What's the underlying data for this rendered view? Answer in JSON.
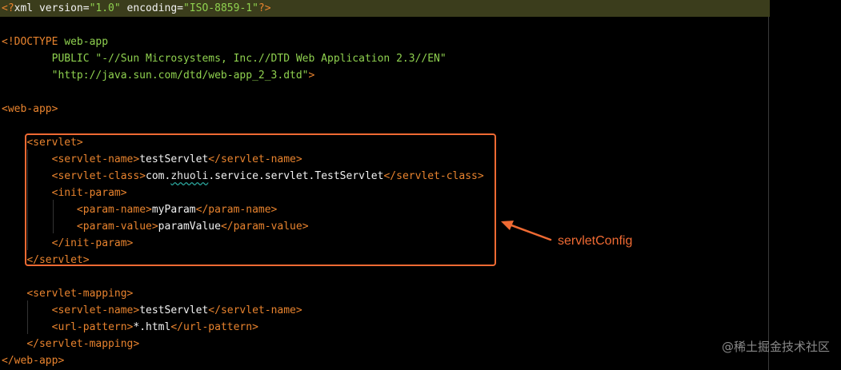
{
  "code_lines": [
    {
      "parts": [
        {
          "t": "<?",
          "c": "tag"
        },
        {
          "t": "xml version=",
          "c": "txt"
        },
        {
          "t": "\"1.0\"",
          "c": "str"
        },
        {
          "t": " encoding=",
          "c": "txt"
        },
        {
          "t": "\"ISO-8859-1\"",
          "c": "str"
        },
        {
          "t": "?>",
          "c": "tag"
        }
      ]
    },
    {
      "parts": []
    },
    {
      "parts": [
        {
          "t": "<!DOCTYPE",
          "c": "tag"
        },
        {
          "t": " web-app",
          "c": "str"
        }
      ]
    },
    {
      "parts": [
        {
          "t": "        PUBLIC ",
          "c": "str"
        },
        {
          "t": "\"-//Sun Microsystems, Inc.//DTD Web Application 2.3//EN\"",
          "c": "str"
        }
      ]
    },
    {
      "parts": [
        {
          "t": "        \"http://java.sun.com/dtd/web-app_2_3.dtd\"",
          "c": "str"
        },
        {
          "t": ">",
          "c": "tag"
        }
      ]
    },
    {
      "parts": []
    },
    {
      "parts": [
        {
          "t": "<web-app>",
          "c": "tag"
        }
      ]
    },
    {
      "parts": []
    },
    {
      "parts": [
        {
          "t": "    ",
          "c": "txt"
        },
        {
          "t": "<servlet>",
          "c": "tag"
        }
      ]
    },
    {
      "parts": [
        {
          "t": "        ",
          "c": "txt"
        },
        {
          "t": "<servlet-name>",
          "c": "tag"
        },
        {
          "t": "testServlet",
          "c": "txt"
        },
        {
          "t": "</servlet-name>",
          "c": "tag"
        }
      ]
    },
    {
      "parts": [
        {
          "t": "        ",
          "c": "txt"
        },
        {
          "t": "<servlet-class>",
          "c": "tag"
        },
        {
          "t": "com.",
          "c": "txt"
        },
        {
          "t": "zhuoli",
          "c": "err"
        },
        {
          "t": ".service.servlet.TestServlet",
          "c": "txt"
        },
        {
          "t": "</servlet-class>",
          "c": "tag"
        }
      ]
    },
    {
      "parts": [
        {
          "t": "        ",
          "c": "txt"
        },
        {
          "t": "<init-param>",
          "c": "tag"
        }
      ]
    },
    {
      "parts": [
        {
          "t": "            ",
          "c": "txt"
        },
        {
          "t": "<param-name>",
          "c": "tag"
        },
        {
          "t": "myParam",
          "c": "txt"
        },
        {
          "t": "</param-name>",
          "c": "tag"
        }
      ]
    },
    {
      "parts": [
        {
          "t": "            ",
          "c": "txt"
        },
        {
          "t": "<param-value>",
          "c": "tag"
        },
        {
          "t": "paramValue",
          "c": "txt"
        },
        {
          "t": "</param-value>",
          "c": "tag"
        }
      ]
    },
    {
      "parts": [
        {
          "t": "        ",
          "c": "txt"
        },
        {
          "t": "</init-param>",
          "c": "tag"
        }
      ]
    },
    {
      "parts": [
        {
          "t": "    ",
          "c": "txt"
        },
        {
          "t": "</servlet>",
          "c": "tag"
        }
      ]
    },
    {
      "parts": []
    },
    {
      "parts": [
        {
          "t": "    ",
          "c": "txt"
        },
        {
          "t": "<servlet-mapping>",
          "c": "tag"
        }
      ]
    },
    {
      "parts": [
        {
          "t": "        ",
          "c": "txt"
        },
        {
          "t": "<servlet-name>",
          "c": "tag"
        },
        {
          "t": "testServlet",
          "c": "txt"
        },
        {
          "t": "</servlet-name>",
          "c": "tag"
        }
      ]
    },
    {
      "parts": [
        {
          "t": "        ",
          "c": "txt"
        },
        {
          "t": "<url-pattern>",
          "c": "tag"
        },
        {
          "t": "*.html",
          "c": "txt"
        },
        {
          "t": "</url-pattern>",
          "c": "tag"
        }
      ]
    },
    {
      "parts": [
        {
          "t": "    ",
          "c": "txt"
        },
        {
          "t": "</servlet-mapping>",
          "c": "tag"
        }
      ]
    },
    {
      "parts": [
        {
          "t": "</web-app>",
          "c": "tag"
        }
      ]
    }
  ],
  "annotation": {
    "label": "servletConfig",
    "color": "#ef6a33"
  },
  "watermark": {
    "text": "@稀土掘金技术社区"
  },
  "colors": {
    "background": "#000000",
    "tag": "#e8832e",
    "string": "#8fd14f",
    "text": "#f2f2f2",
    "current_line": "#3b3d1c",
    "callout": "#ef6a33"
  }
}
